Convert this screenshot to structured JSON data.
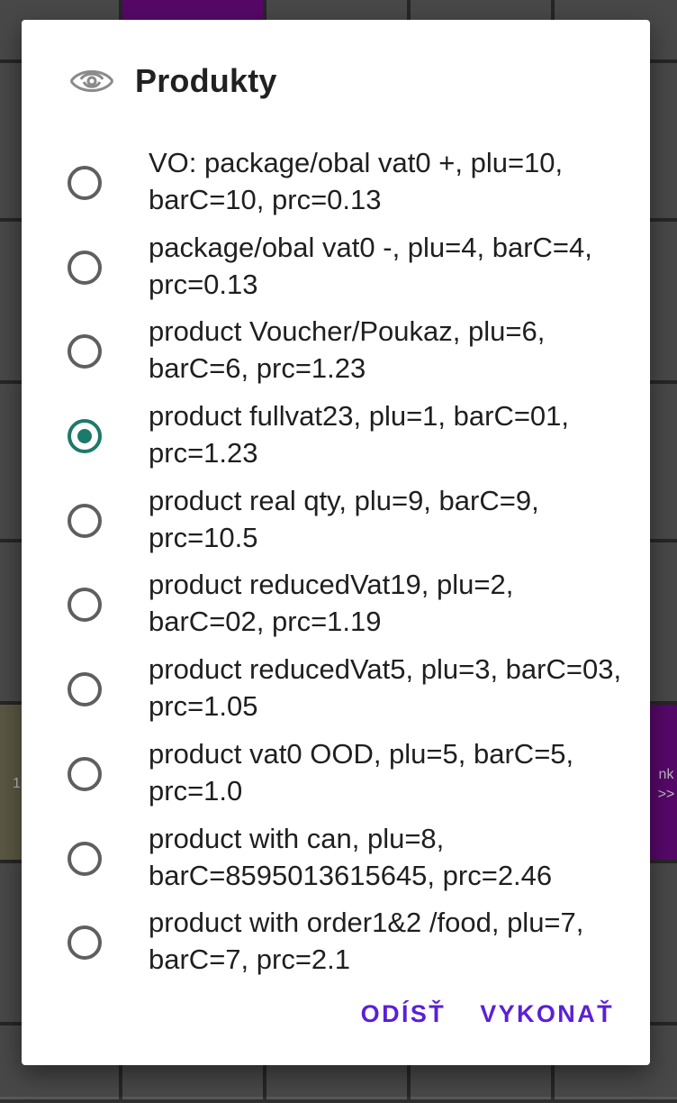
{
  "background": {
    "left_tile_text": [
      "1.",
      "1."
    ],
    "right_tile_text": [
      "nk",
      ">>"
    ]
  },
  "dialog": {
    "title": "Produkty",
    "title_icon": "eye-icon",
    "options": [
      {
        "label": "VO: package/obal vat0 +, plu=10, barC=10, prc=0.13",
        "checked": false
      },
      {
        "label": "package/obal vat0 -, plu=4, barC=4, prc=0.13",
        "checked": false
      },
      {
        "label": "product Voucher/Poukaz, plu=6, barC=6, prc=1.23",
        "checked": false
      },
      {
        "label": "product fullvat23, plu=1, barC=01, prc=1.23",
        "checked": true
      },
      {
        "label": "product real qty, plu=9, barC=9, prc=10.5",
        "checked": false
      },
      {
        "label": "product reducedVat19, plu=2, barC=02, prc=1.19",
        "checked": false
      },
      {
        "label": "product reducedVat5, plu=3, barC=03, prc=1.05",
        "checked": false
      },
      {
        "label": "product vat0 OOD, plu=5, barC=5, prc=1.0",
        "checked": false
      },
      {
        "label": "product with can, plu=8, barC=8595013615645, prc=2.46",
        "checked": false
      },
      {
        "label": "product with order1&2 /food, plu=7, barC=7, prc=2.1",
        "checked": false
      }
    ],
    "cancel_label": "ODÍSŤ",
    "confirm_label": "VYKONAŤ"
  },
  "colors": {
    "accent_radio": "#1c7a6a",
    "button_text": "#5a1fd6",
    "tile_purple": "#6a0a80"
  }
}
